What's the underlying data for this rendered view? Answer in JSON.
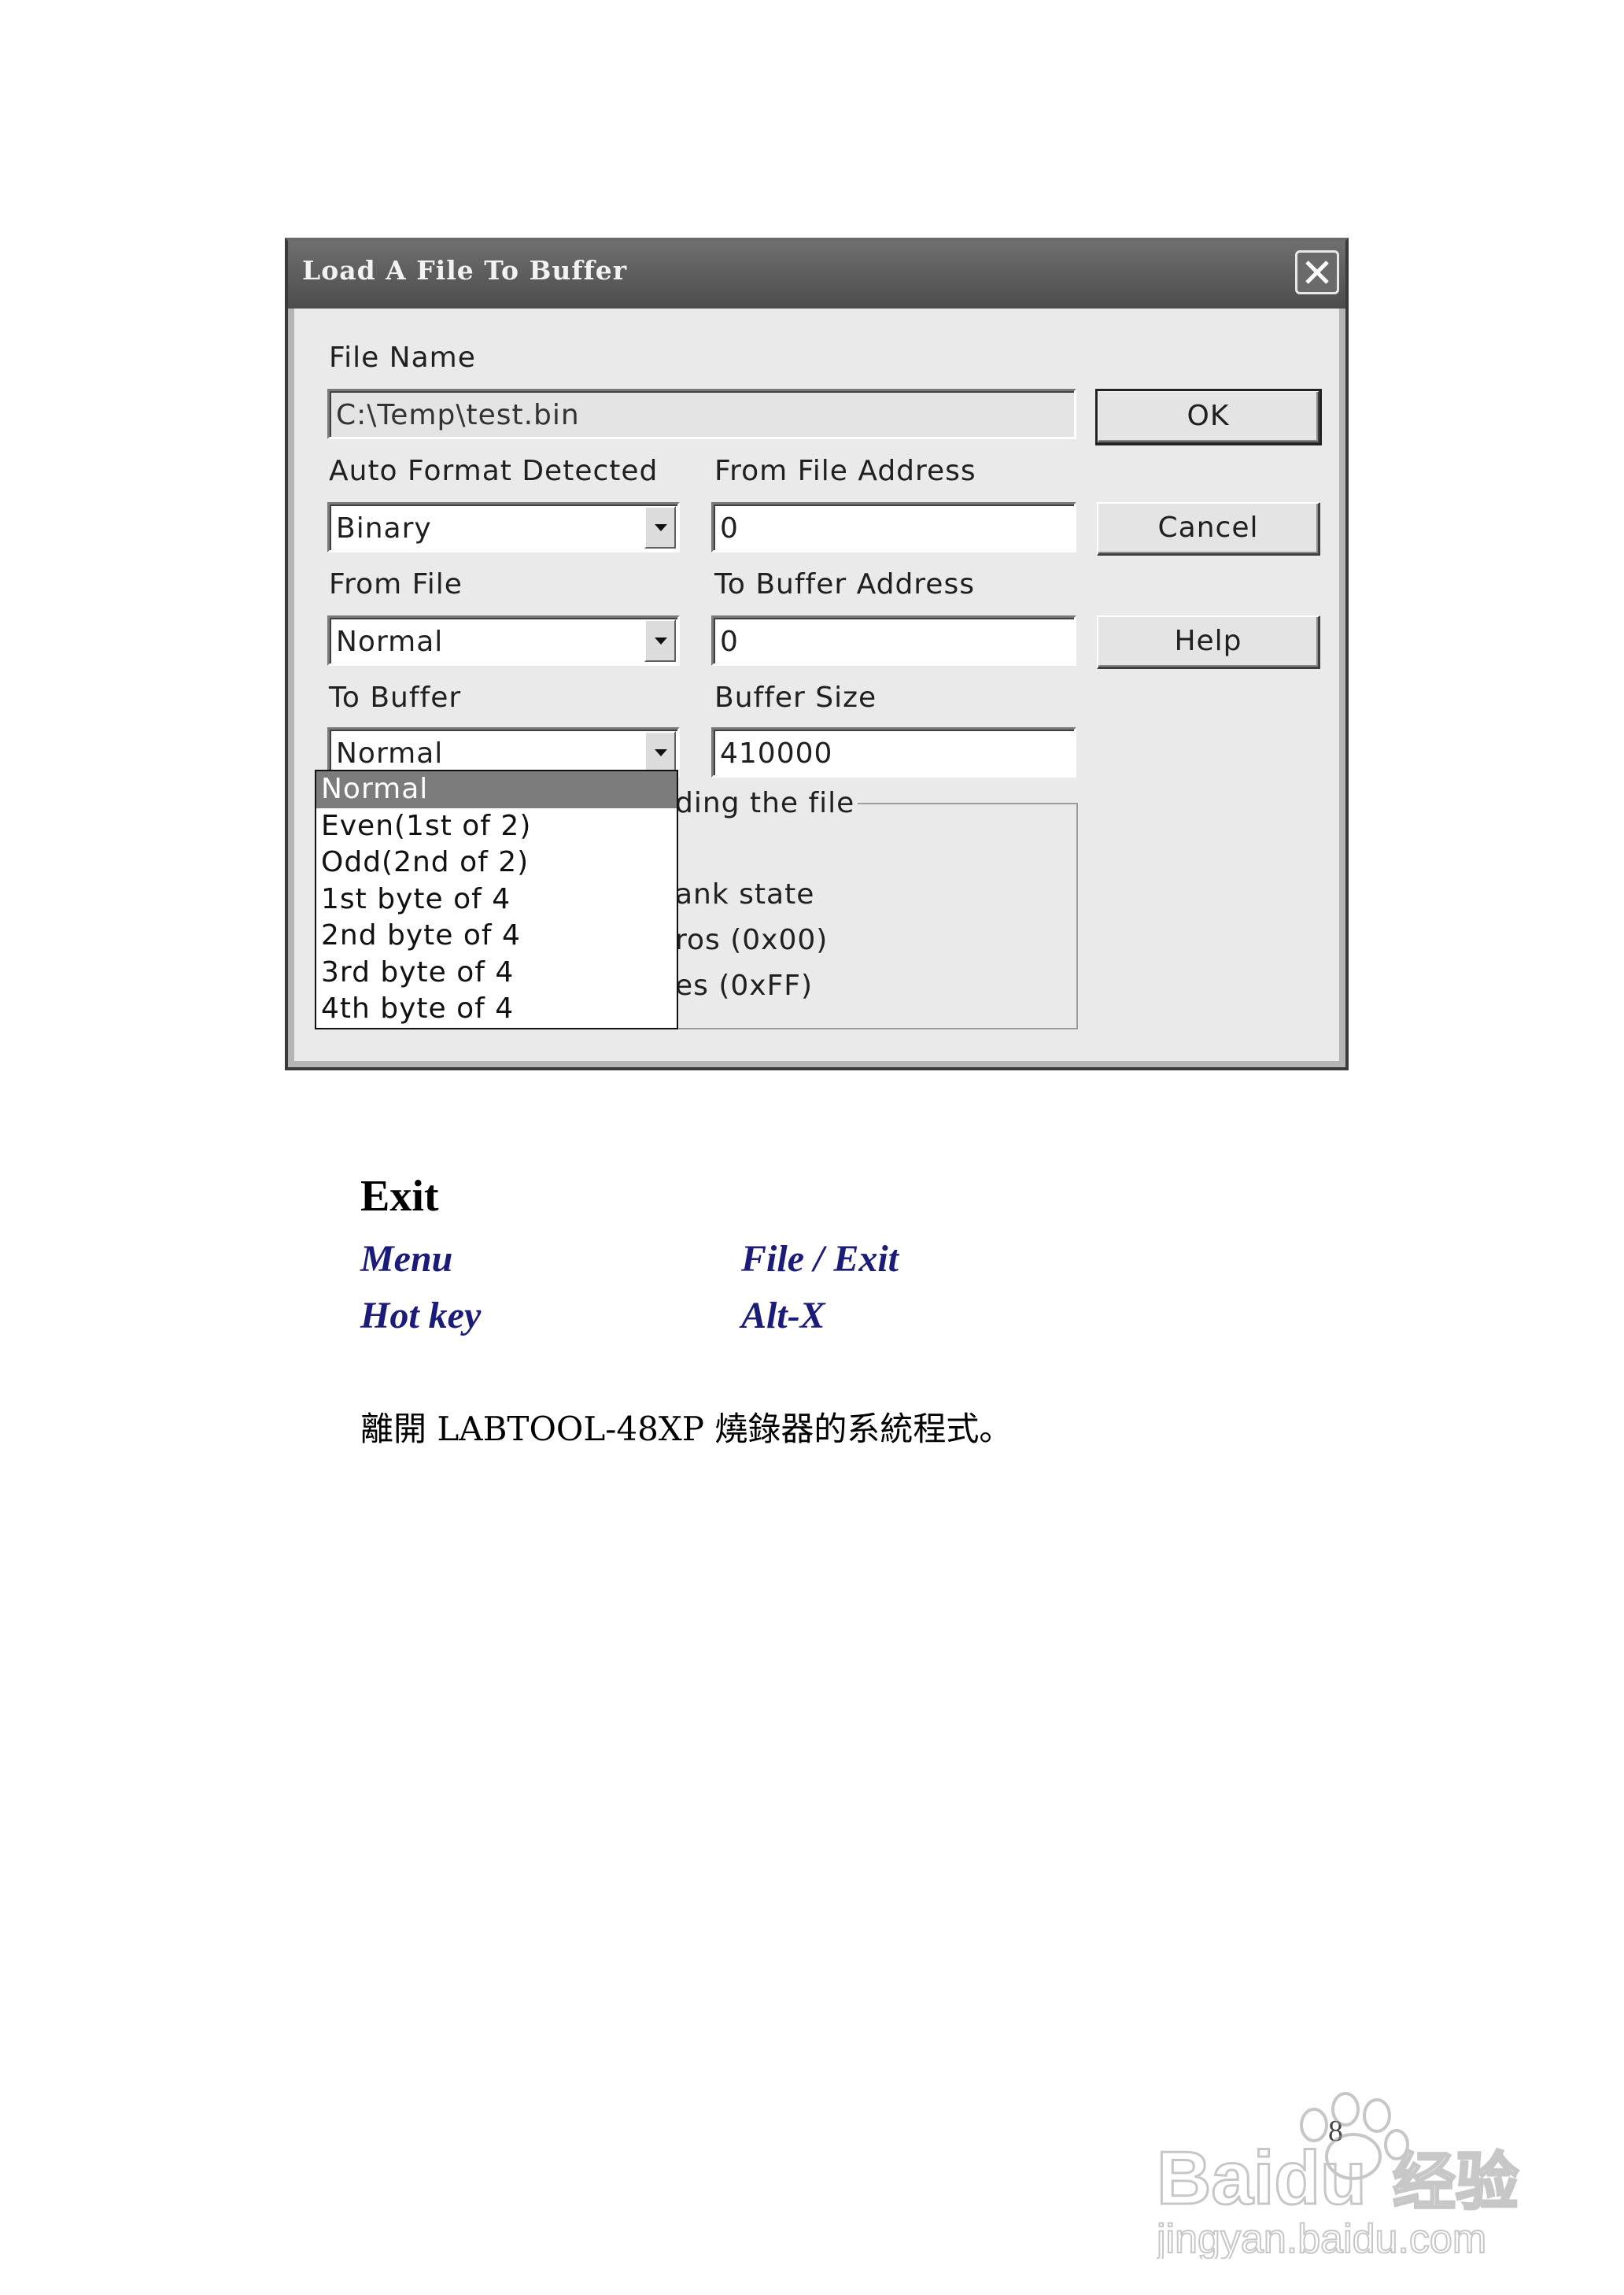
{
  "dialog": {
    "title": "Load A File To Buffer",
    "labels": {
      "file_name": "File Name",
      "auto_format": "Auto Format Detected",
      "from_file_address": "From File Address",
      "from_file": "From File",
      "to_buffer_address": "To Buffer Address",
      "to_buffer": "To Buffer",
      "buffer_size": "Buffer Size"
    },
    "fields": {
      "file_name": "C:\\Temp\\test.bin",
      "auto_format": "Binary",
      "from_file_address": "0",
      "from_file": "Normal",
      "to_buffer_address": "0",
      "to_buffer": "Normal",
      "buffer_size": "410000"
    },
    "buttons": {
      "ok": "OK",
      "cancel": "Cancel",
      "help": "Help"
    },
    "group": {
      "title_partial": "ding the file",
      "options_partial": [
        "ank state",
        "ros (0x00)",
        "es (0xFF)"
      ]
    },
    "dropdown_options": [
      "Normal",
      "Even(1st of 2)",
      "Odd(2nd of 2)",
      "1st byte of 4",
      "2nd byte of 4",
      "3rd byte of 4",
      "4th byte of 4"
    ],
    "dropdown_selected": "Normal"
  },
  "document": {
    "heading": "Exit",
    "rows": [
      {
        "key": "Menu",
        "value": "File / Exit"
      },
      {
        "key": "Hot key",
        "value": "Alt-X"
      }
    ],
    "description": "離開 LABTOOL-48XP 燒錄器的系統程式。",
    "page_number": "8"
  },
  "watermark": {
    "brand": "Baidu",
    "cn": "经验",
    "url": "jingyan.baidu.com"
  },
  "colors": {
    "accent_text": "#1b1b7a",
    "titlebar": "#5a5a5a",
    "selection": "#7c7c7c"
  }
}
